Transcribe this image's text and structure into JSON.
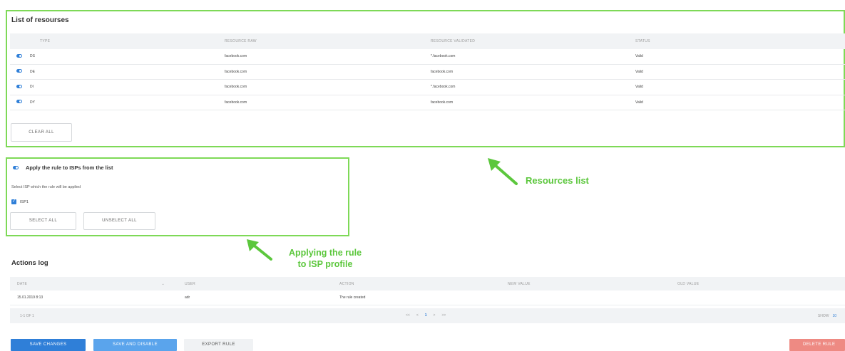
{
  "resources": {
    "title": "List of resourses",
    "columns": [
      "TYPE",
      "RESOURCE RAW",
      "RESOURCE VALIDATED",
      "STATUS"
    ],
    "rows": [
      {
        "type": "DS",
        "raw": "facebook.com",
        "validated": "*.facebook.com",
        "status": "Valid"
      },
      {
        "type": "DE",
        "raw": "facebook.com",
        "validated": "facebook.com",
        "status": "Valid"
      },
      {
        "type": "DI",
        "raw": "facebook.com",
        "validated": "*.facebook.com",
        "status": "Valid"
      },
      {
        "type": "DY",
        "raw": "facebook.com",
        "validated": "facebook.com",
        "status": "Valid"
      }
    ],
    "clear_all": "CLEAR ALL"
  },
  "isp": {
    "title": "Apply the rule to ISPs from the list",
    "subtitle": "Select ISP which the rule will be applied",
    "items": [
      "ISP1"
    ],
    "select_all": "SELECT ALL",
    "unselect_all": "UNSELECT ALL"
  },
  "annotations": {
    "resources": "Resources list",
    "isp_line1": "Applying the rule",
    "isp_line2": "to ISP profile"
  },
  "log": {
    "title": "Actions log",
    "columns": {
      "date": "DATE",
      "user": "USER",
      "action": "ACTION",
      "new": "NEW VALUE",
      "old": "OLD VALUE"
    },
    "rows": [
      {
        "date": "15.01.2019 8:13",
        "user": "adr",
        "action": "The rule created",
        "new": "",
        "old": ""
      }
    ],
    "pagination": {
      "count": "1-1 OF 1",
      "first": "<<",
      "prev": "<",
      "page": "1",
      "next": ">",
      "last": ">>",
      "show_label": "SHOW",
      "show_value": "10"
    }
  },
  "buttons": {
    "save": "SAVE CHANGES",
    "save_disable": "SAVE AND DISABLE",
    "export": "EXPORT RULE",
    "delete": "DELETE RULE"
  },
  "colors": {
    "highlight": "#7ed957",
    "annotation": "#5cc73d",
    "primary": "#2f7fd8",
    "primary_light": "#5aa4ec",
    "danger": "#ee8a83"
  }
}
